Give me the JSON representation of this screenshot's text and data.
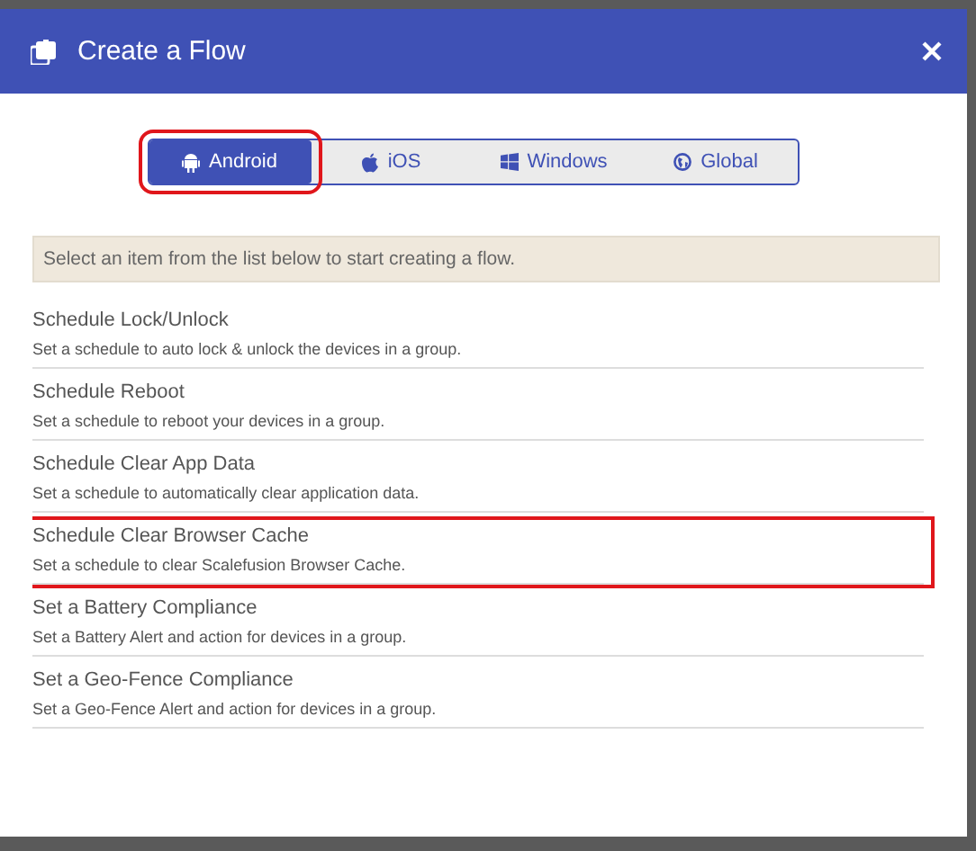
{
  "dialog": {
    "title": "Create a Flow"
  },
  "tabs": [
    {
      "label": "Android",
      "kind": "android",
      "selected": true,
      "highlighted": true
    },
    {
      "label": "iOS",
      "kind": "apple",
      "selected": false,
      "highlighted": false
    },
    {
      "label": "Windows",
      "kind": "windows",
      "selected": false,
      "highlighted": false
    },
    {
      "label": "Global",
      "kind": "globe",
      "selected": false,
      "highlighted": false
    }
  ],
  "info": "Select an item from the list below to start creating a flow.",
  "items": [
    {
      "title": "Schedule Lock/Unlock",
      "description": "Set a schedule to auto lock & unlock the devices in a group.",
      "highlighted": false
    },
    {
      "title": "Schedule Reboot",
      "description": "Set a schedule to reboot your devices in a group.",
      "highlighted": false
    },
    {
      "title": "Schedule Clear App Data",
      "description": "Set a schedule to automatically clear application data.",
      "highlighted": false
    },
    {
      "title": "Schedule Clear Browser Cache",
      "description": "Set a schedule to clear Scalefusion Browser Cache.",
      "highlighted": true
    },
    {
      "title": "Set a Battery Compliance",
      "description": "Set a Battery Alert and action for devices in a group.",
      "highlighted": false
    },
    {
      "title": "Set a Geo-Fence Compliance",
      "description": "Set a Geo-Fence Alert and action for devices in a group.",
      "highlighted": false
    }
  ]
}
